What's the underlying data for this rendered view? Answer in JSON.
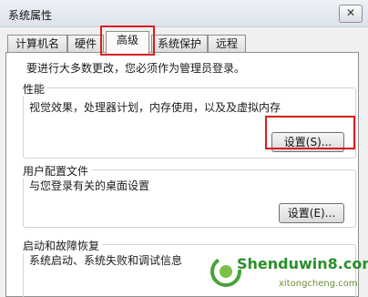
{
  "window": {
    "title": "系统属性",
    "close_label": "✕"
  },
  "tabs": [
    {
      "label": "计算机名",
      "active": false
    },
    {
      "label": "硬件",
      "active": false
    },
    {
      "label": "高级",
      "active": true
    },
    {
      "label": "系统保护",
      "active": false
    },
    {
      "label": "远程",
      "active": false
    }
  ],
  "admin_notice": "要进行大多数更改，您必须作为管理员登录。",
  "performance": {
    "title": "性能",
    "description": "视觉效果，处理器计划，内存使用，以及及虚拟内存",
    "settings_label": "设置(S)..."
  },
  "user_profiles": {
    "title": "用户配置文件",
    "description": "与您登录有关的桌面设置",
    "settings_label": "设置(E)..."
  },
  "startup_recovery": {
    "title": "启动和故障恢复",
    "description": "系统启动、系统失败和调试信息"
  },
  "watermark": {
    "brand": "Shenduwin8.com",
    "sub": "xitongcheng.com"
  },
  "colors": {
    "highlight": "#d81e1e",
    "brand_green": "#2a8f2a"
  }
}
